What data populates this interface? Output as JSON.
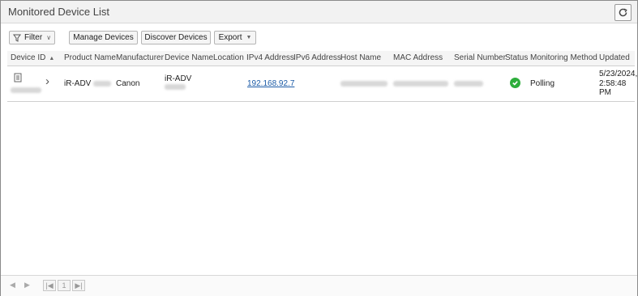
{
  "window": {
    "title": "Monitored Device List"
  },
  "toolbar": {
    "filter_label": "Filter",
    "manage_label": "Manage Devices",
    "discover_label": "Discover Devices",
    "export_label": "Export"
  },
  "table": {
    "columns": [
      "Device ID",
      "Product Name",
      "Manufacturer",
      "Device Name",
      "Location",
      "IPv4 Address",
      "IPv6 Address",
      "Host Name",
      "MAC Address",
      "Serial Number",
      "Status",
      "Monitoring Method",
      "Updated"
    ],
    "rows": [
      {
        "product_name": "iR-ADV",
        "manufacturer": "Canon",
        "device_name": "iR-ADV",
        "ipv4": "192.168.92.7",
        "status": "ok",
        "monitoring_method": "Polling",
        "updated_date": "5/23/2024,",
        "updated_time": "2:58:48",
        "updated_ampm": "PM"
      }
    ]
  },
  "footer": {
    "page_number": "1"
  },
  "colors": {
    "status_ok": "#2eae3c",
    "link": "#1a5aa6"
  }
}
